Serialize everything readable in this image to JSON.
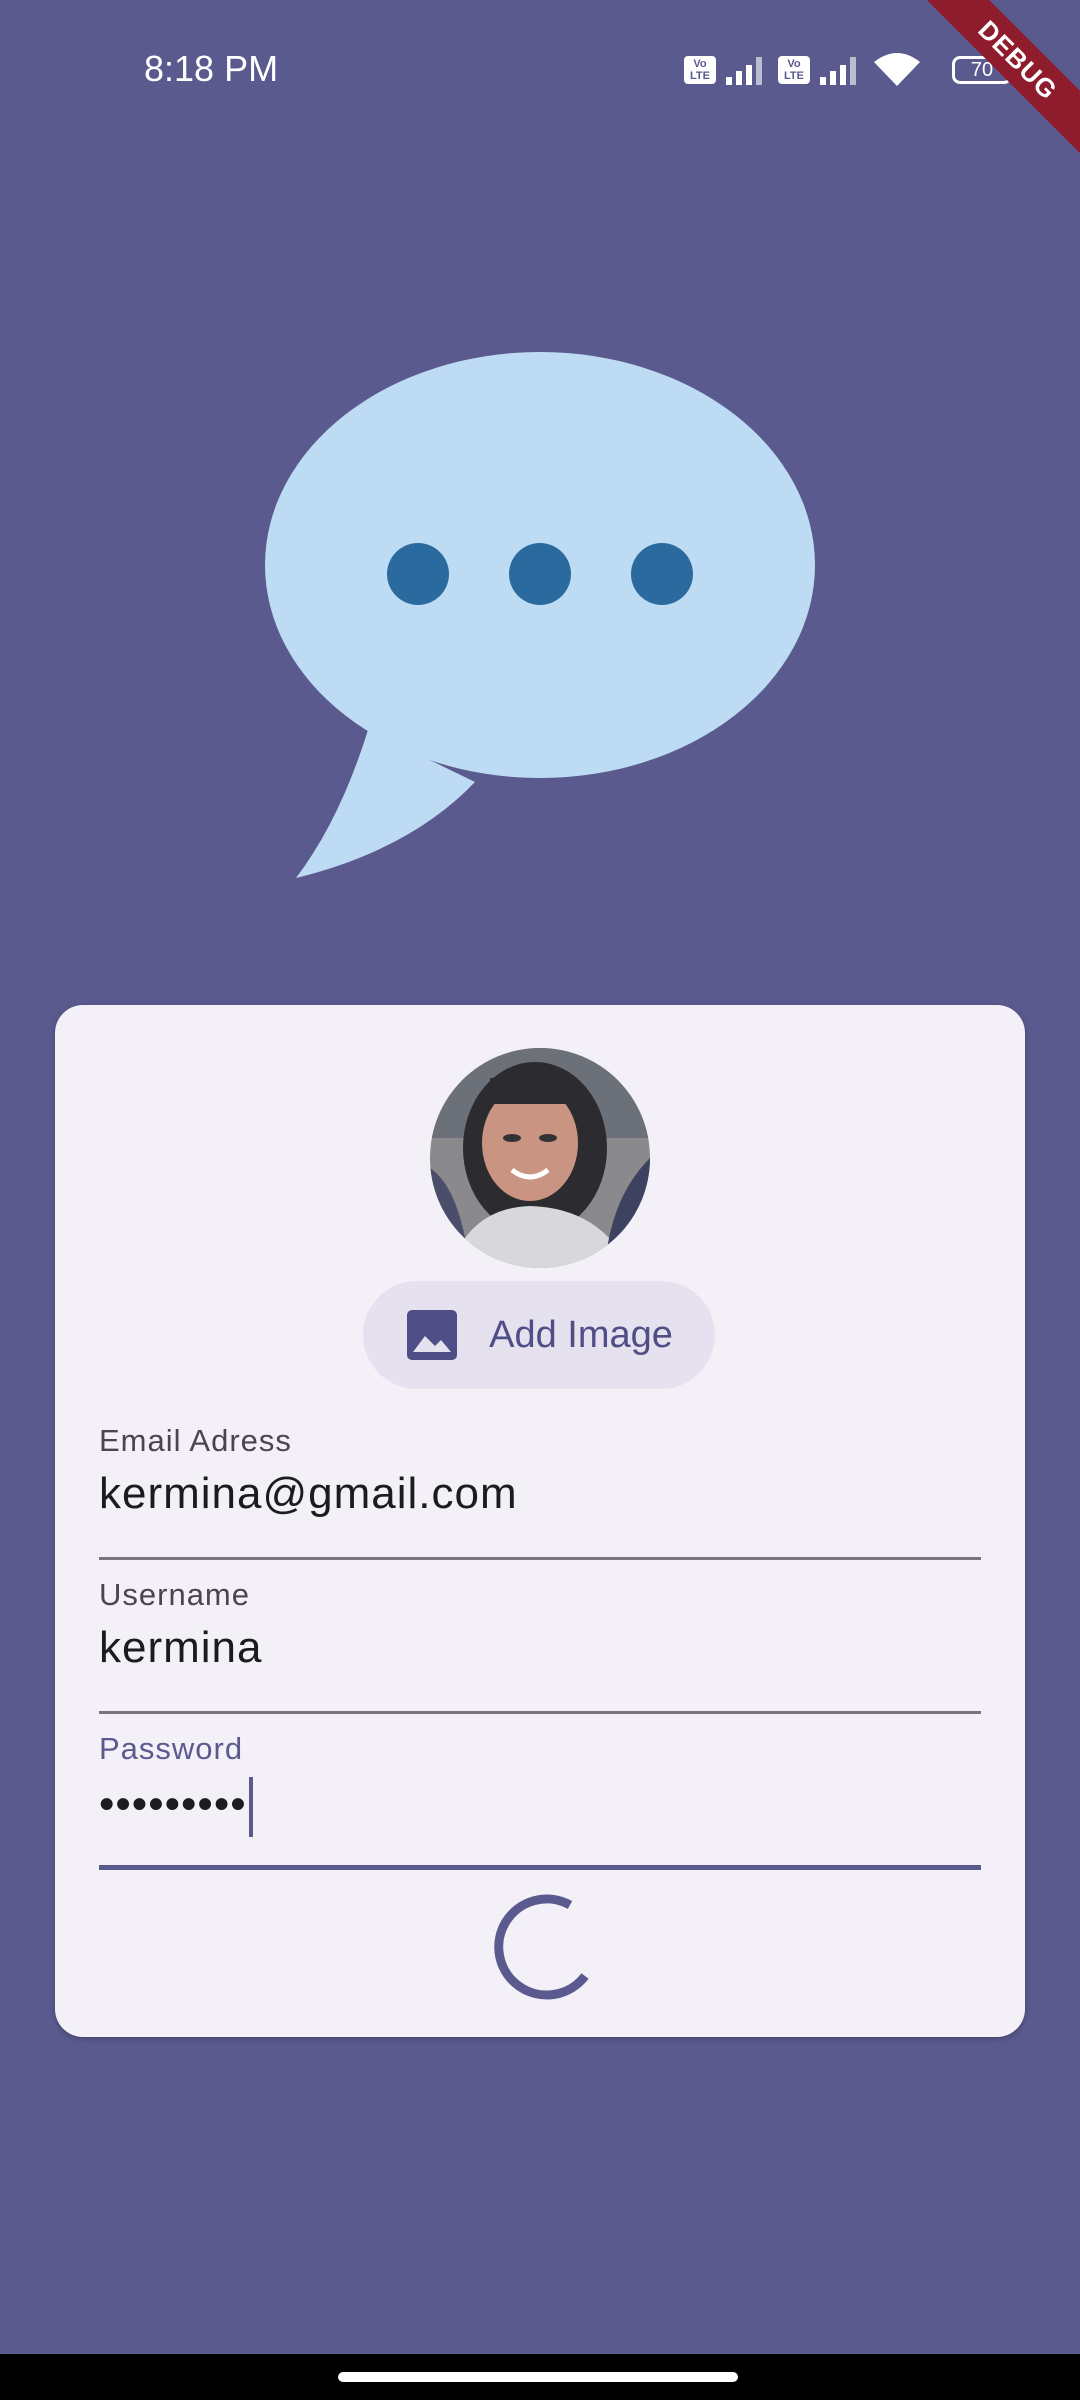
{
  "status_bar": {
    "time": "8:18 PM",
    "volte_label": "Vo LTE",
    "battery_level": "70"
  },
  "debug_banner": "DEBUG",
  "colors": {
    "background": "#5b5a8f",
    "card": "#f4f0f8",
    "accent": "#5b5a8f",
    "bubble": "#bddcf4",
    "bubble_dots": "#2a6a9e"
  },
  "form": {
    "add_image_label": "Add Image",
    "add_image_icon": "image-icon",
    "email": {
      "label": "Email Adress",
      "value": "kermina@gmail.com"
    },
    "username": {
      "label": "Username",
      "value": "kermina"
    },
    "password": {
      "label": "Password",
      "value": "•••••••••"
    },
    "loading": true
  },
  "icons": [
    "chat-bubble-icon",
    "signal-icon",
    "wifi-icon",
    "battery-icon",
    "image-icon",
    "loading-spinner"
  ]
}
